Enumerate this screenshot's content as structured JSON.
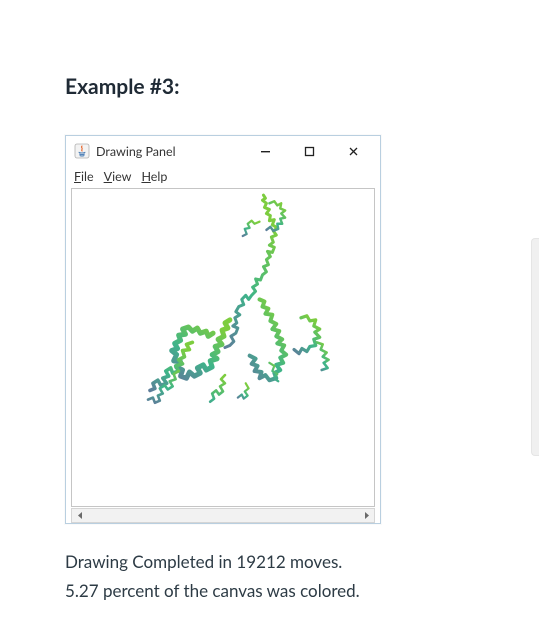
{
  "heading": "Example #3:",
  "window": {
    "title": "Drawing Panel",
    "icon": "java-app-icon",
    "controls": {
      "minimize": "minimize-icon",
      "maximize": "maximize-icon",
      "close": "close-icon"
    },
    "menus": [
      {
        "label": "File",
        "accel": "F"
      },
      {
        "label": "View",
        "accel": "V"
      },
      {
        "label": "Help",
        "accel": "H"
      }
    ],
    "scrollbar": {
      "orientation": "horizontal",
      "left_arrow": "left-arrow-icon",
      "right_arrow": "right-arrow-icon"
    }
  },
  "caption_line_1": "Drawing Completed in 19212 moves.",
  "caption_line_2": "5.27 percent of the canvas was colored.",
  "result": {
    "moves": 19212,
    "percent_colored": 5.27
  },
  "colors": {
    "window_border": "#b9cfe0",
    "text": "#2d3b45",
    "gradient_start": "#5e7d9a",
    "gradient_mid": "#3fb48a",
    "gradient_end": "#7dcd3f"
  }
}
